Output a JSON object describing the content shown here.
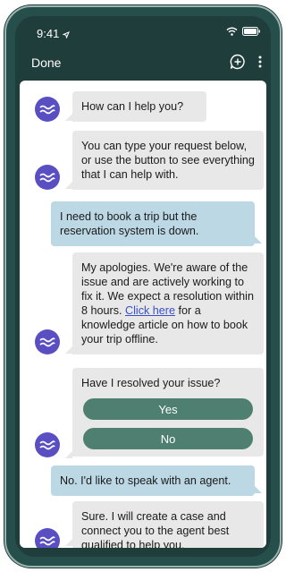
{
  "status": {
    "time": "9:41"
  },
  "nav": {
    "done_label": "Done"
  },
  "messages": {
    "m1": "How can I help you?",
    "m2": "You can type your request below, or use the button to see everything that I can help with.",
    "m3": "I need to book a trip but the reservation system is down.",
    "m4_pre": "My apologies. We're aware of the issue and are actively working to fix it. We expect a resolution within 8 hours.",
    "m4_link": "Click here",
    "m4_post": "for a knowledge article on how to book your trip offline.",
    "m5": "Have I resolved your issue?",
    "m5_yes": "Yes",
    "m5_no": "No",
    "m6": "No. I'd like to speak with an agent.",
    "m7": "Sure. I will create a case and connect you to the agent best qualified to help you."
  },
  "colors": {
    "frame": "#264e4a",
    "bot_bubble": "#e8e8e8",
    "user_bubble": "#bcd8e4",
    "avatar": "#5a4fc2",
    "choice_button": "#4e7f71"
  }
}
